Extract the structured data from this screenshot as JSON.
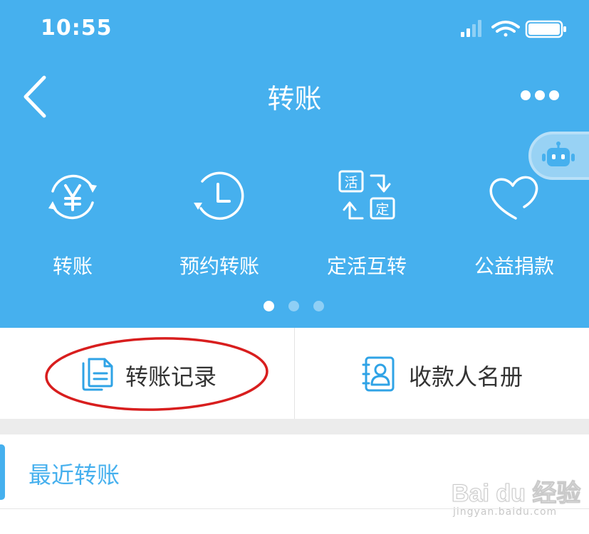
{
  "status_bar": {
    "time": "10:55"
  },
  "nav": {
    "title": "转账"
  },
  "quick_actions": [
    {
      "label": "转账",
      "icon": "yen-cycle-icon"
    },
    {
      "label": "预约转账",
      "icon": "clock-icon"
    },
    {
      "label": "定活互转",
      "icon": "fixed-current-swap-icon",
      "icon_text": [
        "活",
        "定"
      ]
    },
    {
      "label": "公益捐款",
      "icon": "heart-icon"
    }
  ],
  "pager": {
    "total": 3,
    "active_index": 0
  },
  "links": [
    {
      "label": "转账记录",
      "icon": "document-icon"
    },
    {
      "label": "收款人名册",
      "icon": "contact-book-icon"
    }
  ],
  "recent": {
    "title": "最近转账"
  },
  "watermark": {
    "main": "Bai du 经验",
    "sub": "jingyan.baidu.com"
  },
  "colors": {
    "header_bg": "#46b0ee",
    "accent": "#46b0ee",
    "highlight_annotation": "#d81e1e",
    "icon_blue": "#2fa3e6"
  }
}
